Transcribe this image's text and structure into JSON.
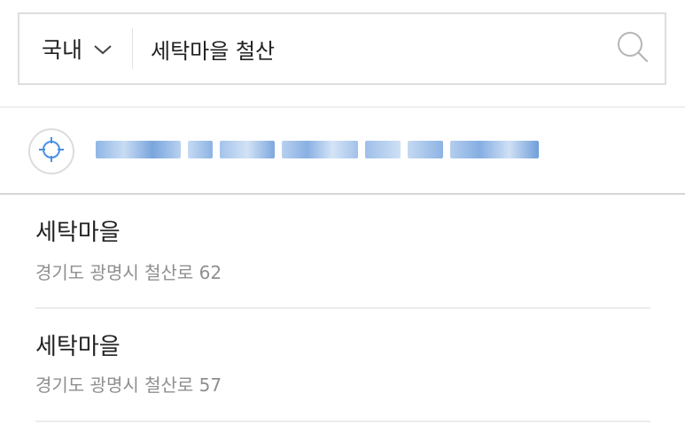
{
  "search": {
    "region_label": "국내",
    "query": "세탁마을 철산"
  },
  "location": {
    "current_address": "(blurred)"
  },
  "results": [
    {
      "name": "세탁마을",
      "address": "경기도 광명시 철산로 62"
    },
    {
      "name": "세탁마을",
      "address": "경기도 광명시 철산로 57"
    }
  ],
  "icons": {
    "region": "chevron-down-icon",
    "search": "search-icon",
    "location": "crosshair-icon"
  },
  "colors": {
    "accent_blue": "#4a90e2",
    "border": "#dedede",
    "secondary_text": "#8f8f8f"
  }
}
